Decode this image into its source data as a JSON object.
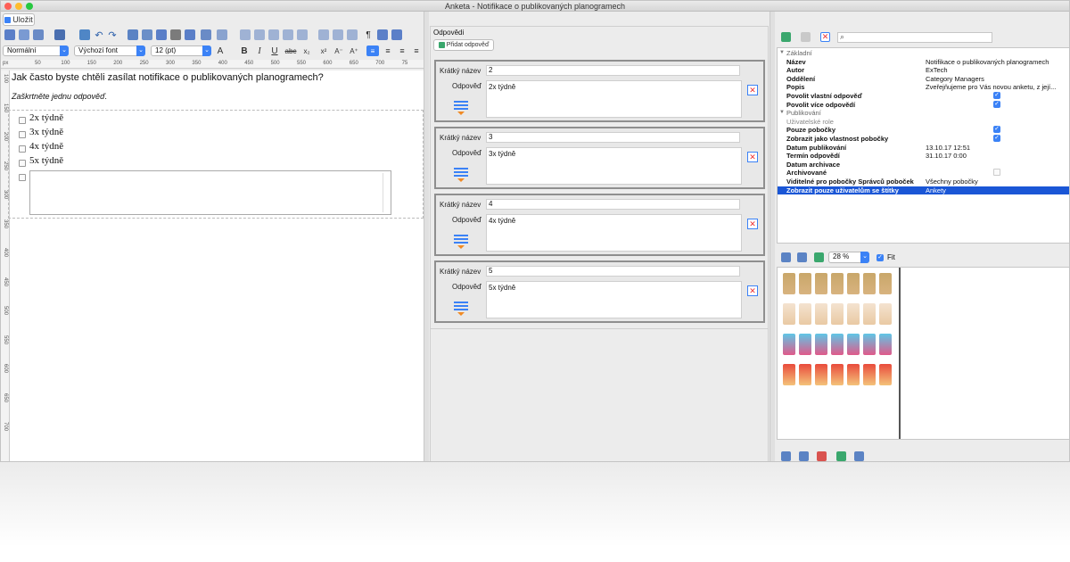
{
  "window": {
    "title": "Anketa - Notifikace o publikovaných planogramech"
  },
  "toolbar": {
    "save_label": "Uložit",
    "style_value": "Normální",
    "font_value": "Výchozí font",
    "size_value": "12 (pt)"
  },
  "ruler": {
    "unit": "px",
    "top_ticks": [
      "50",
      "100",
      "150",
      "200",
      "250",
      "300",
      "350",
      "400",
      "450",
      "500",
      "550",
      "600",
      "650",
      "700",
      "75"
    ],
    "left_ticks": [
      "100",
      "150",
      "200",
      "250",
      "300",
      "350",
      "400",
      "450",
      "500",
      "550",
      "600",
      "650",
      "700"
    ]
  },
  "question": {
    "text": "Jak často byste chtěli zasílat notifikace o publikovaných planogramech?",
    "hint": "Zaškrtněte jednu odpověď.",
    "options": [
      "2x týdně",
      "3x týdně",
      "4x týdně",
      "5x týdně"
    ]
  },
  "answers_panel": {
    "title": "Odpovědi",
    "add_label": "Přidat odpověď",
    "short_label": "Krátký název",
    "answer_label": "Odpověď",
    "items": [
      {
        "short": "2",
        "text": "2x týdně"
      },
      {
        "short": "3",
        "text": "3x týdně"
      },
      {
        "short": "4",
        "text": "4x týdně"
      },
      {
        "short": "5",
        "text": "5x týdně"
      }
    ]
  },
  "properties": {
    "section_basic": "Základní",
    "rows_basic": [
      {
        "key": "Název",
        "value": "Notifikace o publikovaných planogramech"
      },
      {
        "key": "Autor",
        "value": "ExTech"
      },
      {
        "key": "Oddělení",
        "value": "Category Managers"
      },
      {
        "key": "Popis",
        "value": "Zveřejňujeme pro Vás novou anketu, z její..."
      },
      {
        "key": "Povolit vlastní odpověď",
        "value": ""
      },
      {
        "key": "Povolit více odpovědí",
        "value": ""
      }
    ],
    "section_pub": "Publikování",
    "sub_roles": "Uživatelské role",
    "rows_pub": [
      {
        "key": "Pouze pobočky",
        "value": ""
      },
      {
        "key": "Zobrazit jako vlastnost pobočky",
        "value": ""
      },
      {
        "key": "Datum publikování",
        "value": "13.10.17 12:51"
      },
      {
        "key": "Termín odpovědí",
        "value": "31.10.17 0:00"
      },
      {
        "key": "Datum archivace",
        "value": ""
      },
      {
        "key": "Archivované",
        "value": ""
      },
      {
        "key": "Viditelné pro pobočky Správců poboček",
        "value": "Všechny pobočky"
      },
      {
        "key": "Zobrazit pouze uživatelům se štítky",
        "value": "Ankety"
      }
    ]
  },
  "preview": {
    "zoom": "28 %",
    "fit_label": "Fit"
  },
  "colors": {
    "accent": "#3b82f6",
    "selection": "#1a56d6"
  }
}
